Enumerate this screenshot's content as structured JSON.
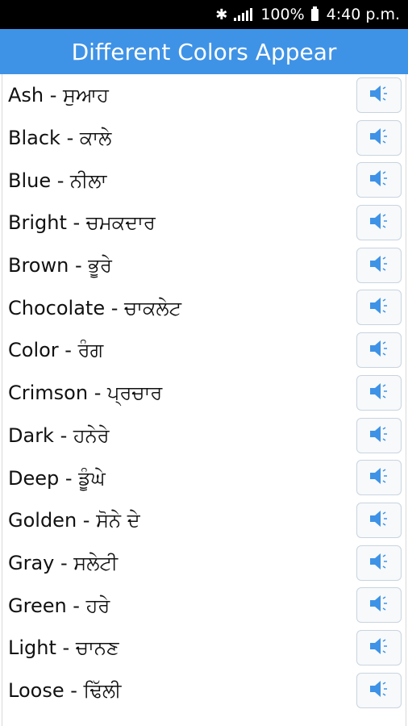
{
  "status_bar": {
    "bluetooth_icon": "bluetooth-icon",
    "signal_icon": "signal-icon",
    "battery_text": "100%",
    "battery_icon": "battery-icon",
    "time": "4:40 p.m."
  },
  "app_bar": {
    "title": "Different Colors Appear"
  },
  "speaker_icon": "speaker-icon",
  "accent_color": "#3f93e6",
  "items": [
    {
      "label": " Ash - ਸੁਆਹ"
    },
    {
      "label": "Black - ਕਾਲੇ"
    },
    {
      "label": "Blue - ਨੀਲਾ"
    },
    {
      "label": "Bright - ਚਮਕਦਾਰ"
    },
    {
      "label": "Brown - ਭੂਰੇ"
    },
    {
      "label": "Chocolate - ਚਾਕਲੇਟ"
    },
    {
      "label": "Color - ਰੰਗ"
    },
    {
      "label": "Crimson - ਪ੍ਰਚਾਰ"
    },
    {
      "label": "Dark - ਹਨੇਰੇ"
    },
    {
      "label": "Deep - ਡੂੰਘੇ"
    },
    {
      "label": "Golden - ਸੋਨੇ ਦੇ"
    },
    {
      "label": "Gray - ਸਲੇਟੀ"
    },
    {
      "label": "Green - ਹਰੇ"
    },
    {
      "label": "Light - ਚਾਨਣ"
    },
    {
      "label": "Loose - ਢਿੱਲੀ"
    }
  ]
}
